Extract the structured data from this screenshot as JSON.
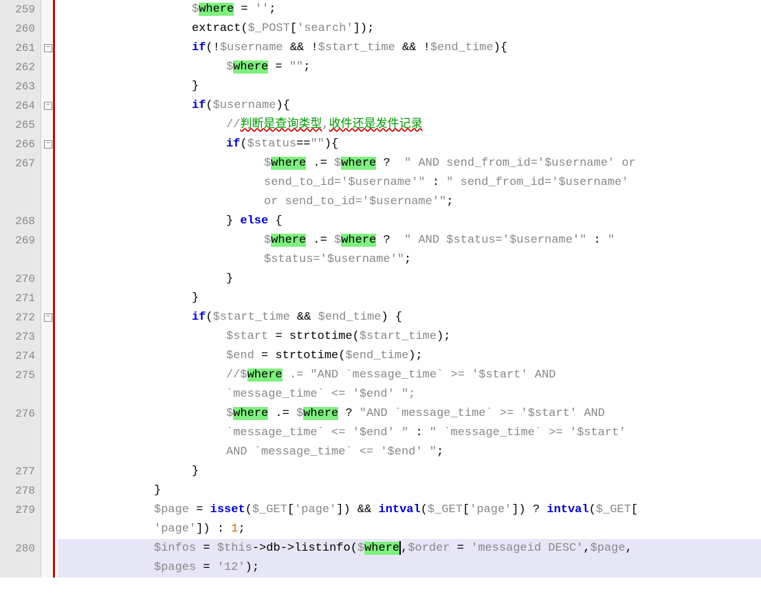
{
  "line_start": 259,
  "line_end": 280,
  "fold_markers": [
    {
      "line": 261,
      "symbol": "−"
    },
    {
      "line": 264,
      "symbol": "−"
    },
    {
      "line": 266,
      "symbol": "−"
    },
    {
      "line": 272,
      "symbol": "−"
    }
  ],
  "highlight_word": "where",
  "selected_line": 280,
  "code": {
    "259": {
      "indent": 3,
      "tokens": [
        {
          "t": "var",
          "v": "$"
        },
        {
          "t": "hl",
          "v": "where"
        },
        {
          "t": "op",
          "v": " = "
        },
        {
          "t": "str",
          "v": "''"
        },
        {
          "t": "op",
          "v": ";"
        }
      ]
    },
    "260": {
      "indent": 3,
      "tokens": [
        {
          "t": "func",
          "v": "extract"
        },
        {
          "t": "paren",
          "v": "("
        },
        {
          "t": "var",
          "v": "$_POST"
        },
        {
          "t": "paren",
          "v": "["
        },
        {
          "t": "str",
          "v": "'search'"
        },
        {
          "t": "paren",
          "v": "])"
        },
        {
          "t": "op",
          "v": ";"
        }
      ]
    },
    "261": {
      "indent": 3,
      "tokens": [
        {
          "t": "kw",
          "v": "if"
        },
        {
          "t": "paren",
          "v": "(!"
        },
        {
          "t": "var",
          "v": "$username"
        },
        {
          "t": "op",
          "v": " && !"
        },
        {
          "t": "var",
          "v": "$start_time"
        },
        {
          "t": "op",
          "v": " && !"
        },
        {
          "t": "var",
          "v": "$end_time"
        },
        {
          "t": "paren",
          "v": "){"
        }
      ]
    },
    "262": {
      "indent": 4,
      "tokens": [
        {
          "t": "var",
          "v": "$"
        },
        {
          "t": "hl",
          "v": "where"
        },
        {
          "t": "op",
          "v": " = "
        },
        {
          "t": "str",
          "v": "\"\""
        },
        {
          "t": "op",
          "v": ";"
        }
      ]
    },
    "263": {
      "indent": 3,
      "tokens": [
        {
          "t": "paren",
          "v": "}"
        }
      ]
    },
    "264": {
      "indent": 3,
      "tokens": [
        {
          "t": "kw",
          "v": "if"
        },
        {
          "t": "paren",
          "v": "("
        },
        {
          "t": "var",
          "v": "$username"
        },
        {
          "t": "paren",
          "v": "){"
        }
      ]
    },
    "265": {
      "indent": 4,
      "tokens": [
        {
          "t": "comment-slash",
          "v": "//"
        },
        {
          "t": "comment-cn",
          "v": "判断是查询类型"
        },
        {
          "t": "comment-slash",
          "v": ","
        },
        {
          "t": "comment-cn",
          "v": "收件还是发件记录"
        }
      ]
    },
    "266": {
      "indent": 4,
      "tokens": [
        {
          "t": "kw",
          "v": "if"
        },
        {
          "t": "paren",
          "v": "("
        },
        {
          "t": "var",
          "v": "$status"
        },
        {
          "t": "op",
          "v": "=="
        },
        {
          "t": "str",
          "v": "\"\""
        },
        {
          "t": "paren",
          "v": "){"
        }
      ]
    },
    "267": {
      "indent": 5,
      "tokens": [
        {
          "t": "var",
          "v": "$"
        },
        {
          "t": "hl",
          "v": "where"
        },
        {
          "t": "op",
          "v": " .= "
        },
        {
          "t": "var",
          "v": "$"
        },
        {
          "t": "hl",
          "v": "where"
        },
        {
          "t": "op",
          "v": " ?  "
        },
        {
          "t": "str",
          "v": "\" AND send_from_id='$username' or"
        }
      ]
    },
    "267b": {
      "indent": 5,
      "tokens": [
        {
          "t": "str",
          "v": "send_to_id='$username'\""
        },
        {
          "t": "op",
          "v": " : "
        },
        {
          "t": "str",
          "v": "\" send_from_id='$username'"
        }
      ]
    },
    "267c": {
      "indent": 5,
      "tokens": [
        {
          "t": "str",
          "v": "or send_to_id='$username'\""
        },
        {
          "t": "op",
          "v": ";"
        }
      ]
    },
    "268": {
      "indent": 4,
      "tokens": [
        {
          "t": "paren",
          "v": "} "
        },
        {
          "t": "kw",
          "v": "else"
        },
        {
          "t": "paren",
          "v": " {"
        }
      ]
    },
    "269": {
      "indent": 5,
      "tokens": [
        {
          "t": "var",
          "v": "$"
        },
        {
          "t": "hl",
          "v": "where"
        },
        {
          "t": "op",
          "v": " .= "
        },
        {
          "t": "var",
          "v": "$"
        },
        {
          "t": "hl",
          "v": "where"
        },
        {
          "t": "op",
          "v": " ?  "
        },
        {
          "t": "str",
          "v": "\" AND $status='$username'\""
        },
        {
          "t": "op",
          "v": " : "
        },
        {
          "t": "str",
          "v": "\""
        }
      ]
    },
    "269b": {
      "indent": 5,
      "tokens": [
        {
          "t": "str",
          "v": "$status='$username'\""
        },
        {
          "t": "op",
          "v": ";"
        }
      ]
    },
    "270": {
      "indent": 4,
      "tokens": [
        {
          "t": "paren",
          "v": "}"
        }
      ]
    },
    "271": {
      "indent": 3,
      "tokens": [
        {
          "t": "paren",
          "v": "}"
        }
      ]
    },
    "272": {
      "indent": 3,
      "tokens": [
        {
          "t": "kw",
          "v": "if"
        },
        {
          "t": "paren",
          "v": "("
        },
        {
          "t": "var",
          "v": "$start_time"
        },
        {
          "t": "op",
          "v": " && "
        },
        {
          "t": "var",
          "v": "$end_time"
        },
        {
          "t": "paren",
          "v": ") {"
        }
      ]
    },
    "273": {
      "indent": 4,
      "tokens": [
        {
          "t": "var",
          "v": "$start"
        },
        {
          "t": "op",
          "v": " = "
        },
        {
          "t": "func",
          "v": "strtotime"
        },
        {
          "t": "paren",
          "v": "("
        },
        {
          "t": "var",
          "v": "$start_time"
        },
        {
          "t": "paren",
          "v": ")"
        },
        {
          "t": "op",
          "v": ";"
        }
      ]
    },
    "274": {
      "indent": 4,
      "tokens": [
        {
          "t": "var",
          "v": "$end"
        },
        {
          "t": "op",
          "v": " = "
        },
        {
          "t": "func",
          "v": "strtotime"
        },
        {
          "t": "paren",
          "v": "("
        },
        {
          "t": "var",
          "v": "$end_time"
        },
        {
          "t": "paren",
          "v": ")"
        },
        {
          "t": "op",
          "v": ";"
        }
      ]
    },
    "275": {
      "indent": 4,
      "tokens": [
        {
          "t": "comment-slash",
          "v": "//"
        },
        {
          "t": "var",
          "v": "$"
        },
        {
          "t": "hl",
          "v": "where"
        },
        {
          "t": "str",
          "v": " .= \"AND `message_time` >= '$start' AND"
        }
      ]
    },
    "275b": {
      "indent": 4,
      "tokens": [
        {
          "t": "str",
          "v": "`message_time` <= '$end' \";"
        }
      ]
    },
    "276": {
      "indent": 4,
      "tokens": [
        {
          "t": "var",
          "v": "$"
        },
        {
          "t": "hl",
          "v": "where"
        },
        {
          "t": "op",
          "v": " .= "
        },
        {
          "t": "var",
          "v": "$"
        },
        {
          "t": "hl",
          "v": "where"
        },
        {
          "t": "op",
          "v": " ? "
        },
        {
          "t": "str",
          "v": "\"AND `message_time` >= '$start' AND"
        }
      ]
    },
    "276b": {
      "indent": 4,
      "tokens": [
        {
          "t": "str",
          "v": "`message_time` <= '$end' \""
        },
        {
          "t": "op",
          "v": " : "
        },
        {
          "t": "str",
          "v": "\" `message_time` >= '$start'"
        }
      ]
    },
    "276c": {
      "indent": 4,
      "tokens": [
        {
          "t": "str",
          "v": "AND `message_time` <= '$end' \""
        },
        {
          "t": "op",
          "v": ";"
        }
      ]
    },
    "277": {
      "indent": 3,
      "tokens": [
        {
          "t": "paren",
          "v": "}"
        }
      ]
    },
    "278": {
      "indent": 2,
      "tokens": [
        {
          "t": "paren",
          "v": "}"
        }
      ]
    },
    "279": {
      "indent": 2,
      "tokens": [
        {
          "t": "var",
          "v": "$page"
        },
        {
          "t": "op",
          "v": " = "
        },
        {
          "t": "kw",
          "v": "isset"
        },
        {
          "t": "paren",
          "v": "("
        },
        {
          "t": "var",
          "v": "$_GET"
        },
        {
          "t": "paren",
          "v": "["
        },
        {
          "t": "str",
          "v": "'page'"
        },
        {
          "t": "paren",
          "v": "])"
        },
        {
          "t": "op",
          "v": " && "
        },
        {
          "t": "kw",
          "v": "intval"
        },
        {
          "t": "paren",
          "v": "("
        },
        {
          "t": "var",
          "v": "$_GET"
        },
        {
          "t": "paren",
          "v": "["
        },
        {
          "t": "str",
          "v": "'page'"
        },
        {
          "t": "paren",
          "v": "])"
        },
        {
          "t": "op",
          "v": " ? "
        },
        {
          "t": "kw",
          "v": "intval"
        },
        {
          "t": "paren",
          "v": "("
        },
        {
          "t": "var",
          "v": "$_GET"
        },
        {
          "t": "paren",
          "v": "["
        }
      ]
    },
    "279b": {
      "indent": 2,
      "tokens": [
        {
          "t": "str",
          "v": "'page'"
        },
        {
          "t": "paren",
          "v": "])"
        },
        {
          "t": "op",
          "v": " : "
        },
        {
          "t": "num",
          "v": "1"
        },
        {
          "t": "op",
          "v": ";"
        }
      ]
    },
    "280": {
      "indent": 2,
      "tokens": [
        {
          "t": "var",
          "v": "$infos"
        },
        {
          "t": "op",
          "v": " = "
        },
        {
          "t": "var",
          "v": "$this"
        },
        {
          "t": "op",
          "v": "->"
        },
        {
          "t": "ident",
          "v": "db"
        },
        {
          "t": "op",
          "v": "->"
        },
        {
          "t": "func",
          "v": "listinfo"
        },
        {
          "t": "paren",
          "v": "("
        },
        {
          "t": "var",
          "v": "$"
        },
        {
          "t": "hl",
          "v": "where"
        },
        {
          "t": "cursor",
          "v": ""
        },
        {
          "t": "op",
          "v": ","
        },
        {
          "t": "var",
          "v": "$order"
        },
        {
          "t": "op",
          "v": " = "
        },
        {
          "t": "str",
          "v": "'messageid DESC'"
        },
        {
          "t": "op",
          "v": ","
        },
        {
          "t": "var",
          "v": "$page"
        },
        {
          "t": "op",
          "v": ","
        }
      ]
    },
    "280b": {
      "indent": 2,
      "tokens": [
        {
          "t": "var",
          "v": "$pages"
        },
        {
          "t": "op",
          "v": " = "
        },
        {
          "t": "str",
          "v": "'12'"
        },
        {
          "t": "paren",
          "v": ")"
        },
        {
          "t": "op",
          "v": ";"
        }
      ]
    }
  },
  "render_order": [
    "259",
    "260",
    "261",
    "262",
    "263",
    "264",
    "265",
    "266",
    "267",
    "267b",
    "267c",
    "268",
    "269",
    "269b",
    "270",
    "271",
    "272",
    "273",
    "274",
    "275",
    "275b",
    "276",
    "276b",
    "276c",
    "277",
    "278",
    "279",
    "279b",
    "280",
    "280b"
  ],
  "wrap_lines": [
    "267b",
    "267c",
    "269b",
    "275b",
    "276b",
    "276c",
    "279b",
    "280b"
  ]
}
